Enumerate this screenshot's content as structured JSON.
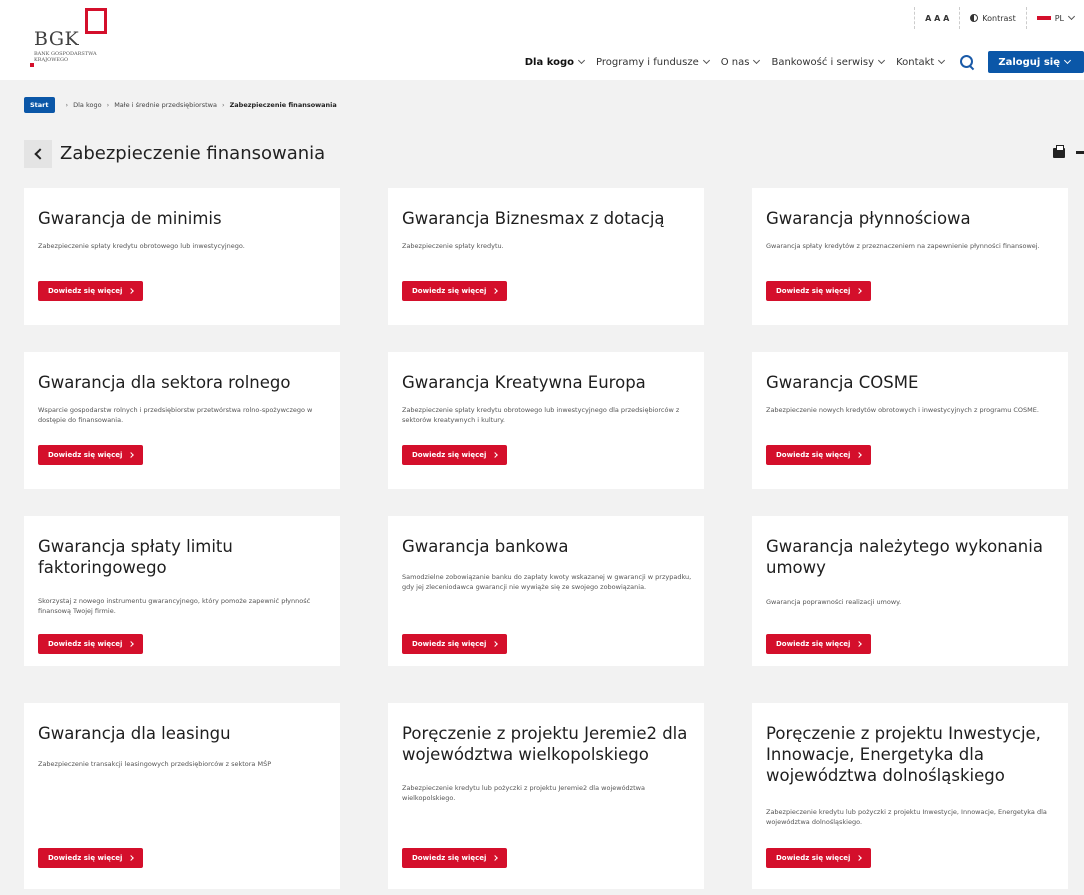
{
  "header": {
    "logo": {
      "text": "BGK",
      "subtitle": "BANK GOSPODARSTWA KRAJOWEGO"
    },
    "tools": {
      "font_size": "A A A",
      "contrast": "Kontrast",
      "language": "PL"
    },
    "nav": [
      {
        "label": "Dla kogo"
      },
      {
        "label": "Programy i fundusze"
      },
      {
        "label": "O nas"
      },
      {
        "label": "Bankowość i serwisy"
      },
      {
        "label": "Kontakt"
      }
    ],
    "login_label": "Zaloguj się"
  },
  "breadcrumb": {
    "start": "Start",
    "items": [
      "Dla kogo",
      "Małe i średnie przedsiębiorstwa",
      "Zabezpieczenie finansowania"
    ]
  },
  "page": {
    "title": "Zabezpieczenie finansowania"
  },
  "cards": [
    {
      "title": "Gwarancja de minimis",
      "desc": "Zabezpieczenie spłaty kredytu obrotowego lub inwestycyjnego.",
      "button": "Dowiedz się więcej"
    },
    {
      "title": "Gwarancja Biznesmax z dotacją",
      "desc": "Zabezpieczenie spłaty kredytu.",
      "button": "Dowiedz się więcej"
    },
    {
      "title": "Gwarancja płynnościowa",
      "desc": "Gwarancja spłaty kredytów z przeznaczeniem na zapewnienie płynności finansowej.",
      "button": "Dowiedz się więcej"
    },
    {
      "title": "Gwarancja dla sektora rolnego",
      "desc": "Wsparcie gospodarstw rolnych i przedsiębiorstw przetwórstwa rolno-spożywczego w dostępie do finansowania.",
      "button": "Dowiedz się więcej"
    },
    {
      "title": "Gwarancja Kreatywna Europa",
      "desc": "Zabezpieczenie spłaty kredytu obrotowego lub inwestycyjnego dla przedsiębiorców z sektorów kreatywnych i kultury.",
      "button": "Dowiedz się więcej"
    },
    {
      "title": "Gwarancja COSME",
      "desc": "Zabezpieczenie nowych kredytów obrotowych i inwestycyjnych z programu COSME.",
      "button": "Dowiedz się więcej"
    },
    {
      "title": "Gwarancja spłaty limitu faktoringowego",
      "desc": "Skorzystaj z nowego instrumentu gwarancyjnego, który pomoże zapewnić płynność finansową Twojej firmie.",
      "button": "Dowiedz się więcej"
    },
    {
      "title": "Gwarancja bankowa",
      "desc": "Samodzielne zobowiązanie banku do zapłaty kwoty wskazanej w gwarancji w przypadku, gdy jej zleceniodawca gwarancji nie wywiąże się ze swojego zobowiązania.",
      "button": "Dowiedz się więcej"
    },
    {
      "title": "Gwarancja należytego wykonania umowy",
      "desc": "Gwarancja poprawności realizacji umowy.",
      "button": "Dowiedz się więcej"
    },
    {
      "title": "Gwarancja dla leasingu",
      "desc": "Zabezpieczenie transakcji leasingowych przedsiębiorców z sektora MŚP",
      "button": "Dowiedz się więcej"
    },
    {
      "title": "Poręczenie z projektu Jeremie2 dla województwa wielkopolskiego",
      "desc": "Zabezpieczenie kredytu lub pożyczki z projektu Jeremie2 dla województwa wielkopolskiego.",
      "button": "Dowiedz się więcej"
    },
    {
      "title": "Poręczenie z projektu Inwestycje, Innowacje, Energetyka dla województwa dolnośląskiego",
      "desc": "Zabezpieczenie kredytu lub pożyczki z projektu Inwestycje, Innowacje, Energetyka dla województwa dolnośląskiego.",
      "button": "Dowiedz się więcej"
    }
  ],
  "colors": {
    "brand_red": "#d40f2b",
    "brand_blue": "#0b57a8"
  }
}
